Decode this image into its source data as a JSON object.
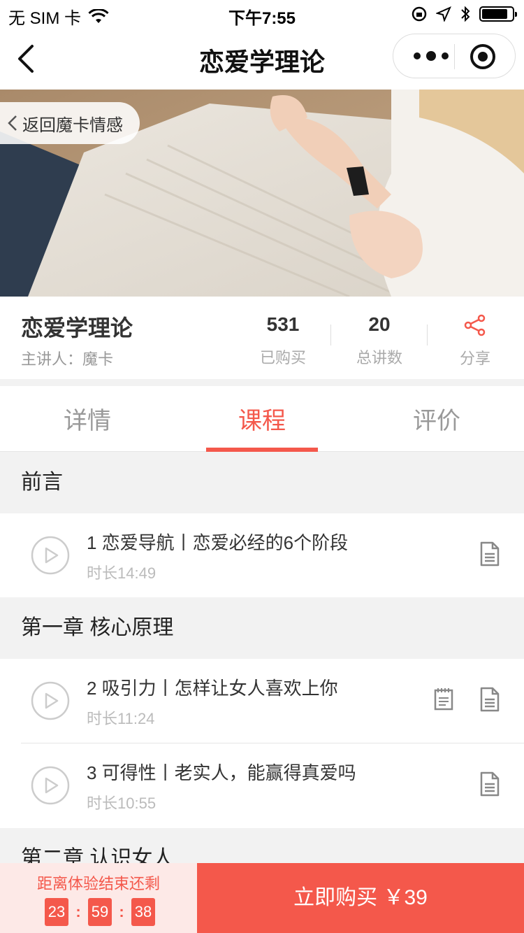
{
  "status_bar": {
    "carrier": "无 SIM 卡",
    "time": "下午7:55",
    "battery_level": 0.85
  },
  "nav": {
    "title": "恋爱学理论",
    "icons": [
      "back-arrow-icon",
      "more-dots-icon",
      "close-circle-icon"
    ]
  },
  "hero": {
    "back_label": "返回魔卡情感"
  },
  "course": {
    "title": "恋爱学理论",
    "lecturer": "主讲人：魔卡",
    "purchased_count": "531",
    "purchased_label": "已购买",
    "lecture_count": "20",
    "lecture_label": "总讲数",
    "share_label": "分享"
  },
  "tabs": [
    {
      "label": "详情"
    },
    {
      "label": "课程"
    },
    {
      "label": "评价"
    }
  ],
  "active_tab": "课程",
  "sections": [
    {
      "title": "前言",
      "lessons": [
        {
          "title": "1 恋爱导航丨恋爱必经的6个阶段",
          "duration": "时长14:49"
        }
      ]
    },
    {
      "title": "第一章 核心原理",
      "lessons": [
        {
          "title": "2 吸引力丨怎样让女人喜欢上你",
          "duration": "时长11:24"
        },
        {
          "title": "3 可得性丨老实人，能赢得真爱吗",
          "duration": "时长10:55"
        }
      ]
    },
    {
      "title": "第二章 认识女人"
    }
  ],
  "bottom": {
    "trial_text": "距离体验结束还剩",
    "timer": {
      "hours": "23",
      "minutes": "59",
      "seconds": "38"
    },
    "buy_label": "立即购买 ￥39"
  },
  "colors": {
    "accent": "#f4584b",
    "muted": "#999999",
    "section_bg": "#f2f2f2"
  }
}
